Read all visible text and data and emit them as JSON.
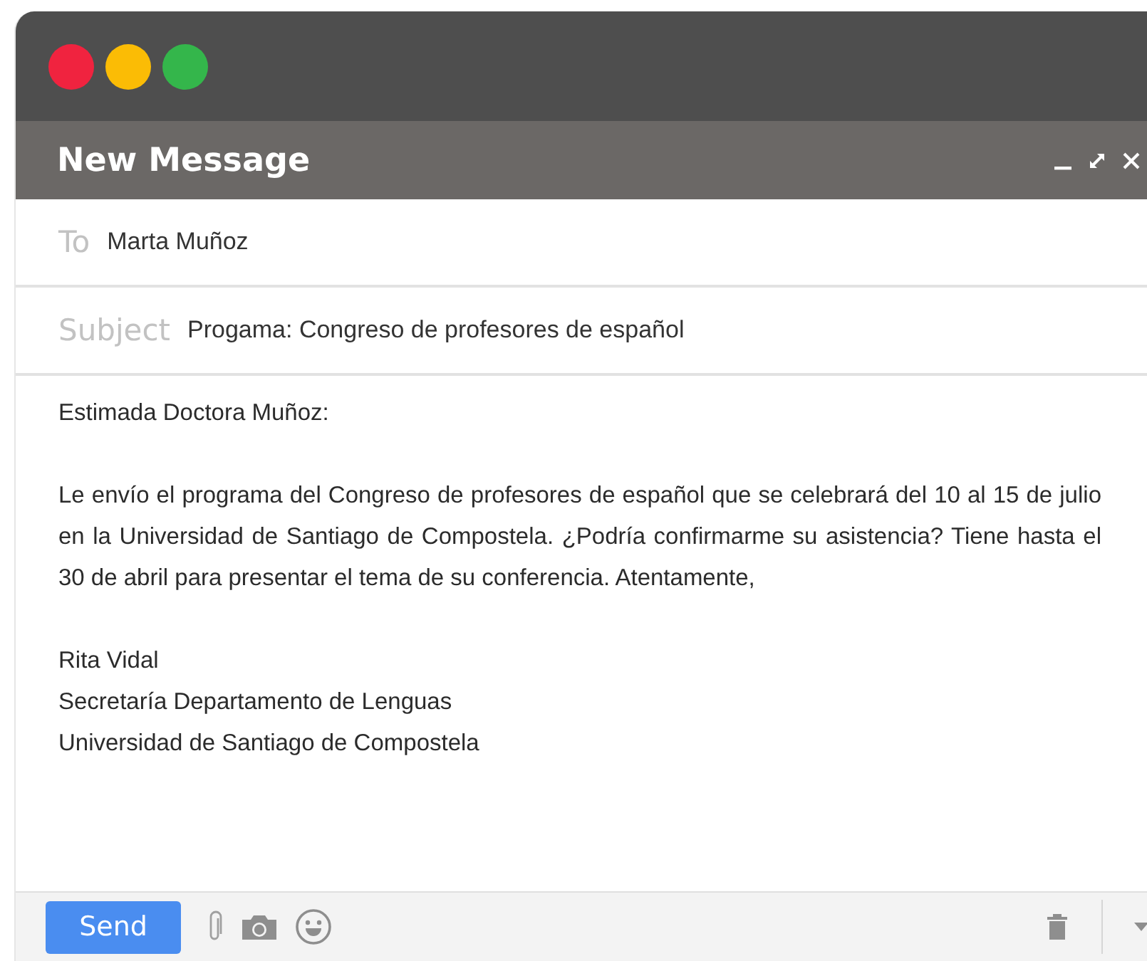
{
  "window": {
    "title": "New Message"
  },
  "to": {
    "label": "To",
    "value": "Marta Muñoz"
  },
  "subject": {
    "label": "Subject",
    "value": "Progama: Congreso de profesores de español"
  },
  "body": {
    "greeting": "Estimada Doctora Muñoz:",
    "paragraph": "Le envío el programa del Congreso de profesores de español que se celebrará del 10 al 15 de julio en la Universidad de Santiago de Compostela. ¿Podría confirmarme su asistencia? Tiene hasta el 30 de abril para presentar el tema de su conferencia. Atentamente,",
    "signature": [
      "Rita Vidal",
      "Secretaría Departamento de Lenguas",
      "Universidad de Santiago de Compostela"
    ]
  },
  "toolbar": {
    "send": "Send"
  }
}
